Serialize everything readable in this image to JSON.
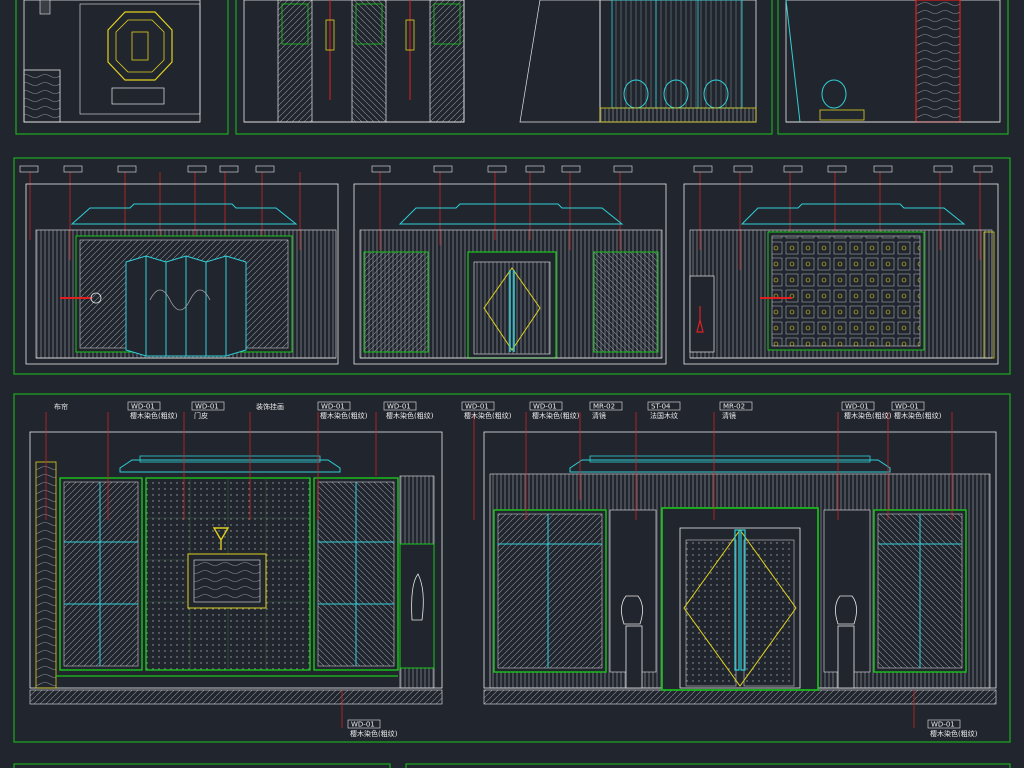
{
  "colors": {
    "background": "#21262e",
    "frame": "#19c719",
    "outline": "#e8e8e8",
    "cyan": "#2fd0d8",
    "red": "#e02020",
    "yellow": "#e0d020",
    "hatch": "#8a8f96"
  },
  "bottom_left": {
    "tags": [
      {
        "code": "",
        "text": "布帘"
      },
      {
        "code": "WD-01",
        "text": "樱木染色(粗纹)"
      },
      {
        "code": "WD-01",
        "text": "门皮"
      },
      {
        "code": "",
        "text": "装饰挂画"
      },
      {
        "code": "WD-01",
        "text": "樱木染色(粗纹)"
      },
      {
        "code": "WD-01",
        "text": "樱木染色(粗纹)"
      }
    ],
    "bottom_tag": {
      "code": "WD-01",
      "text": "樱木染色(粗纹)"
    }
  },
  "bottom_right": {
    "tags": [
      {
        "code": "WD-01",
        "text": "樱木染色(粗纹)"
      },
      {
        "code": "WD-01",
        "text": "樱木染色(粗纹)"
      },
      {
        "code": "MR-02",
        "text": "清镜"
      },
      {
        "code": "ST-04",
        "text": "法国木纹"
      },
      {
        "code": "MR-02",
        "text": "清镜"
      },
      {
        "code": "WD-01",
        "text": "樱木染色(粗纹)"
      },
      {
        "code": "WD-01",
        "text": "樱木染色(粗纹)"
      }
    ],
    "bottom_tag": {
      "code": "WD-01",
      "text": "樱木染色(粗纹)"
    }
  }
}
